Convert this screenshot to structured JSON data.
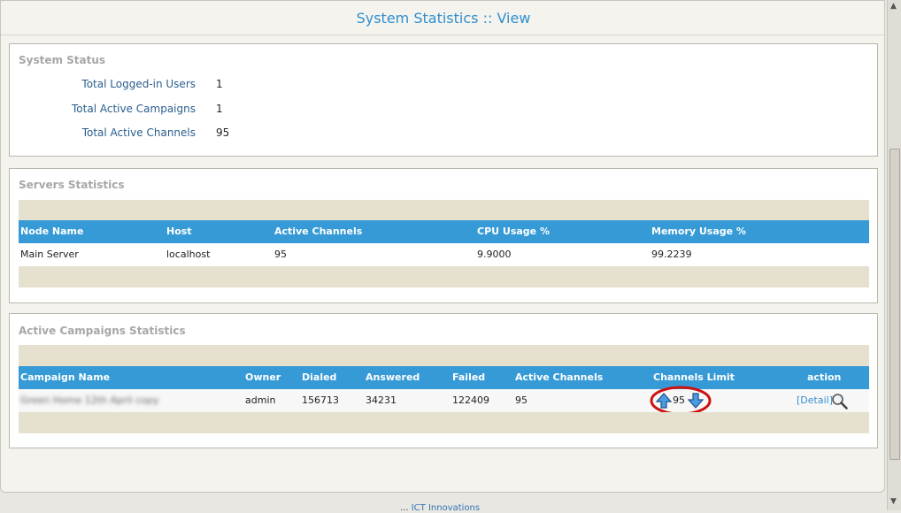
{
  "page": {
    "title": "System Statistics :: View"
  },
  "system_status": {
    "title": "System Status",
    "rows": [
      {
        "label": "Total Logged-in Users",
        "value": "1"
      },
      {
        "label": "Total Active Campaigns",
        "value": "1"
      },
      {
        "label": "Total Active Channels",
        "value": "95"
      }
    ]
  },
  "servers": {
    "title": "Servers Statistics",
    "columns": [
      "Node Name",
      "Host",
      "Active Channels",
      "CPU Usage %",
      "Memory Usage %"
    ],
    "rows": [
      {
        "node": "Main Server",
        "host": "localhost",
        "channels": "95",
        "cpu": "9.9000",
        "memory": "99.2239"
      }
    ]
  },
  "campaigns": {
    "title": "Active Campaigns Statistics",
    "columns": [
      "Campaign Name",
      "Owner",
      "Dialed",
      "Answered",
      "Failed",
      "Active Channels",
      "Channels Limit",
      "action"
    ],
    "rows": [
      {
        "name": "Green Home 12th April copy",
        "owner": "admin",
        "dialed": "156713",
        "answered": "34231",
        "failed": "122409",
        "active": "95",
        "limit": "95",
        "action": "[Detail]"
      }
    ]
  },
  "footer": {
    "prefix": "...",
    "link": "ICT Innovations"
  },
  "colors": {
    "header": "#359ad6",
    "title": "#2f8fcf",
    "label": "#2a5e8e",
    "beige": "#e6e1cf",
    "highlight": "#cc1111"
  }
}
